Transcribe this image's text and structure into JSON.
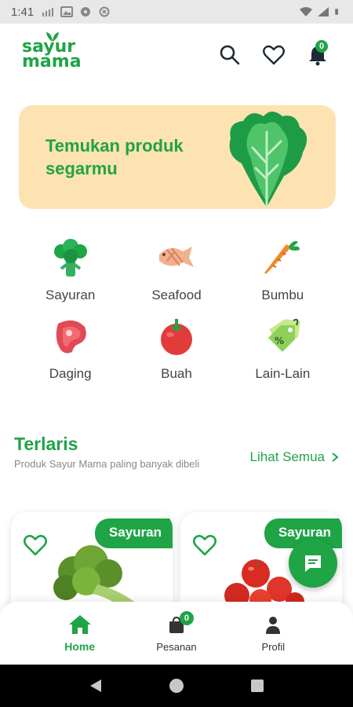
{
  "status_bar": {
    "time": "1:41"
  },
  "header": {
    "logo_line1": "sayur",
    "logo_line2": "mama",
    "notification_count": "0"
  },
  "banner": {
    "text": "Temukan produk segarmu"
  },
  "categories": [
    {
      "label": "Sayuran",
      "icon": "broccoli-icon"
    },
    {
      "label": "Seafood",
      "icon": "fish-icon"
    },
    {
      "label": "Bumbu",
      "icon": "carrot-icon"
    },
    {
      "label": "Daging",
      "icon": "meat-icon"
    },
    {
      "label": "Buah",
      "icon": "tomato-icon"
    },
    {
      "label": "Lain-Lain",
      "icon": "discount-tag-icon"
    }
  ],
  "best_seller": {
    "title": "Terlaris",
    "subtitle": "Produk Sayur Mama paling banyak dibeli",
    "see_all": "Lihat Semua"
  },
  "products": [
    {
      "badge": "Sayuran",
      "icon": "broccoli-image"
    },
    {
      "badge": "Sayuran",
      "icon": "tomatoes-image"
    }
  ],
  "bottom_nav": {
    "home": "Home",
    "orders": "Pesanan",
    "orders_count": "0",
    "profile": "Profil"
  },
  "colors": {
    "brand_green": "#1fa446",
    "banner_bg": "#fde2b2"
  }
}
